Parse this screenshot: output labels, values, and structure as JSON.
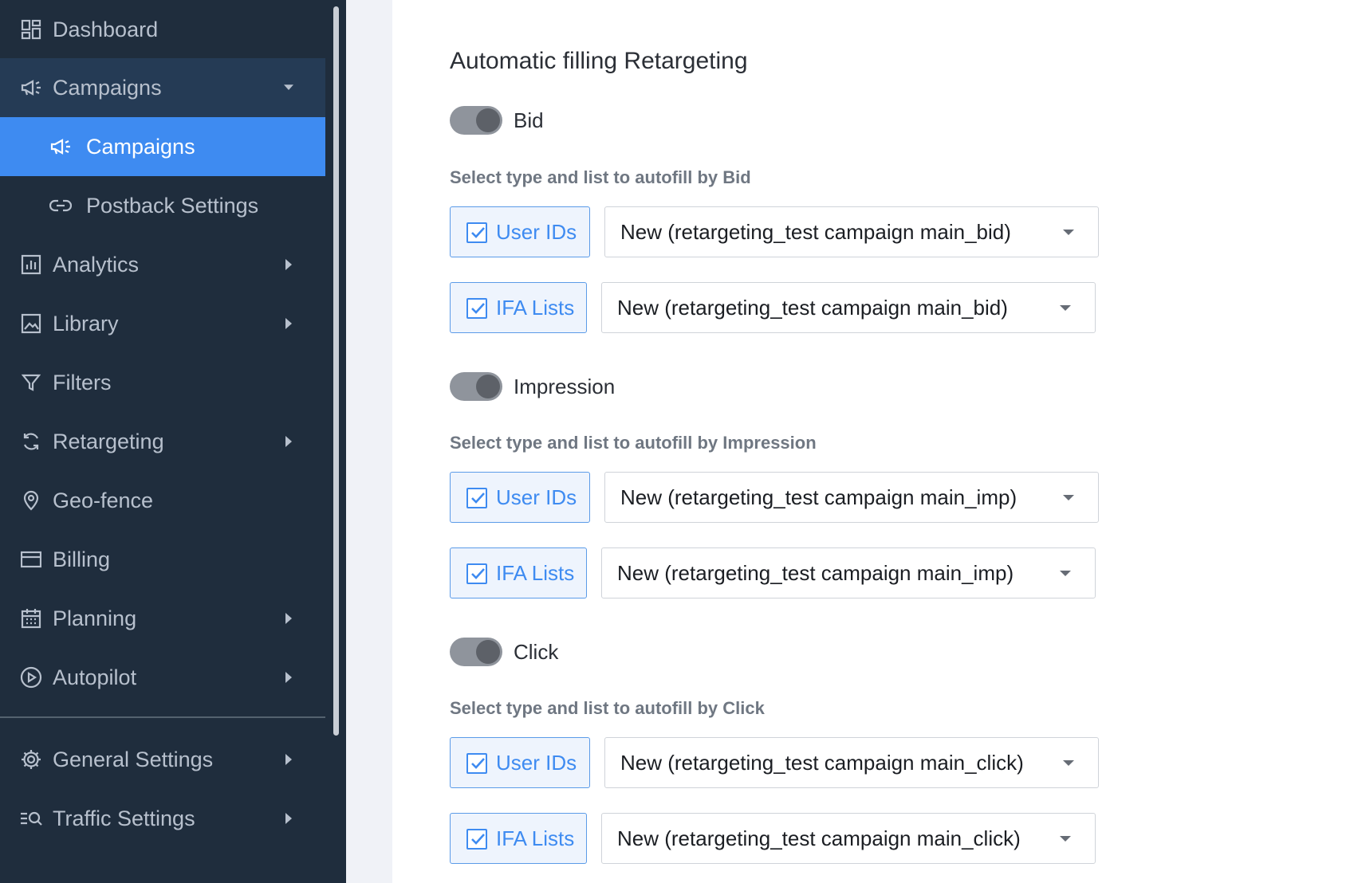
{
  "sidebar": {
    "items": [
      {
        "label": "Dashboard",
        "icon": "dashboard-icon"
      },
      {
        "label": "Campaigns",
        "icon": "megaphone-icon",
        "expanded": true
      },
      {
        "label": "Campaigns",
        "icon": "megaphone-icon",
        "active": true
      },
      {
        "label": "Postback Settings",
        "icon": "link-icon"
      },
      {
        "label": "Analytics",
        "icon": "bar-chart-icon"
      },
      {
        "label": "Library",
        "icon": "image-icon"
      },
      {
        "label": "Filters",
        "icon": "filter-icon"
      },
      {
        "label": "Retargeting",
        "icon": "refresh-icon"
      },
      {
        "label": "Geo-fence",
        "icon": "map-pin-icon"
      },
      {
        "label": "Billing",
        "icon": "credit-card-icon"
      },
      {
        "label": "Planning",
        "icon": "calendar-icon"
      },
      {
        "label": "Autopilot",
        "icon": "play-circle-icon"
      },
      {
        "label": "General Settings",
        "icon": "gear-icon"
      },
      {
        "label": "Traffic Settings",
        "icon": "list-search-icon"
      }
    ]
  },
  "main": {
    "title": "Automatic filling Retargeting",
    "sections": [
      {
        "toggle_label": "Bid",
        "hint": "Select type and list to autofill by Bid",
        "rows": [
          {
            "type_label": "User IDs",
            "checked": true,
            "selected": "New (retargeting_test campaign main_bid)"
          },
          {
            "type_label": "IFA Lists",
            "checked": true,
            "selected": "New (retargeting_test campaign main_bid)"
          }
        ]
      },
      {
        "toggle_label": "Impression",
        "hint": "Select type and list to autofill by Impression",
        "rows": [
          {
            "type_label": "User IDs",
            "checked": true,
            "selected": "New (retargeting_test campaign main_imp)"
          },
          {
            "type_label": "IFA Lists",
            "checked": true,
            "selected": "New (retargeting_test campaign main_imp)"
          }
        ]
      },
      {
        "toggle_label": "Click",
        "hint": "Select type and list to autofill by Click",
        "rows": [
          {
            "type_label": "User IDs",
            "checked": true,
            "selected": "New (retargeting_test campaign main_click)"
          },
          {
            "type_label": "IFA Lists",
            "checked": true,
            "selected": "New (retargeting_test campaign main_click)"
          }
        ]
      }
    ]
  },
  "colors": {
    "sidebar_bg": "#1f2d3d",
    "sidebar_open_bg": "#253b55",
    "accent": "#3e8bf1",
    "toggle_off": "#8f949c"
  }
}
